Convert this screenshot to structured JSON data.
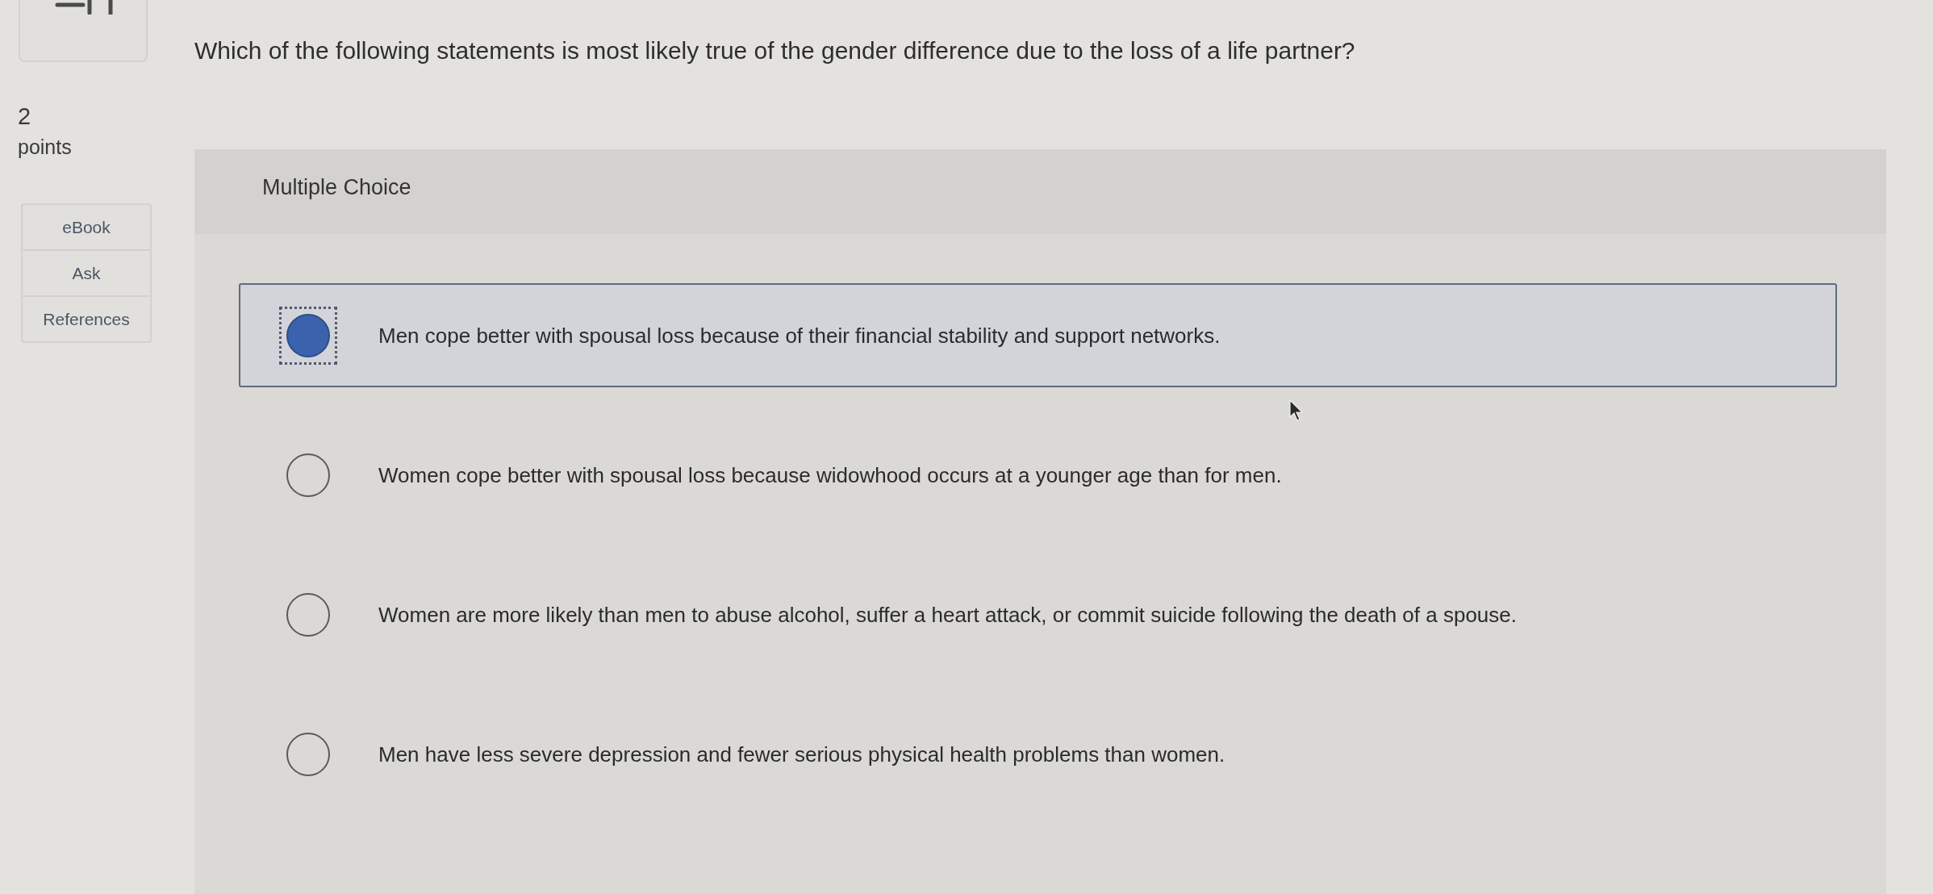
{
  "sidebar": {
    "points_value": "2",
    "points_label": "points",
    "tools": [
      "eBook",
      "Ask",
      "References"
    ]
  },
  "question": {
    "text": "Which of the following statements is most likely true of the gender difference due to the loss of a life partner?"
  },
  "answer_panel": {
    "type_label": "Multiple Choice",
    "options": [
      {
        "text": "Men cope better with spousal loss because of their financial stability and support networks.",
        "selected": true
      },
      {
        "text": "Women cope better with spousal loss because widowhood occurs at a younger age than for men.",
        "selected": false
      },
      {
        "text": "Women are more likely than men to abuse alcohol, suffer a heart attack, or commit suicide following the death of a spouse.",
        "selected": false
      },
      {
        "text": "Men have less severe depression and fewer serious physical health problems than women.",
        "selected": false
      }
    ]
  }
}
